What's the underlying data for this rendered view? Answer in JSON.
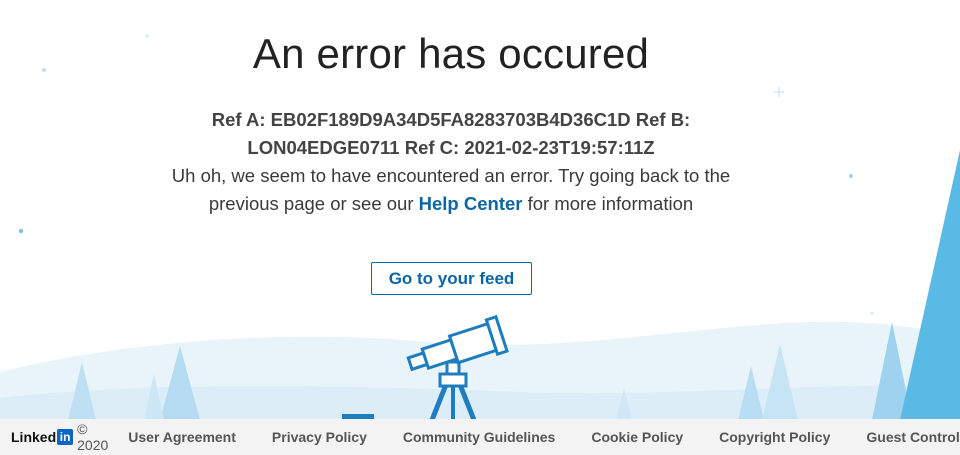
{
  "error": {
    "title": "An error has occured",
    "refs_line1": "Ref A: EB02F189D9A34D5FA8283703B4D36C1D Ref B:",
    "refs_line2": "LON04EDGE0711 Ref C: 2021-02-23T19:57:11Z",
    "message_part1": "Uh oh, we seem to have encountered an error. Try going back to the previous page or see our ",
    "help_link": "Help Center",
    "message_part2": " for more information"
  },
  "actions": {
    "feed_button": "Go to your feed"
  },
  "footer": {
    "brand_text": "Linked",
    "brand_in": "in",
    "copyright": "© 2020",
    "links": [
      "User Agreement",
      "Privacy Policy",
      "Community Guidelines",
      "Cookie Policy",
      "Copyright Policy",
      "Guest Controls"
    ]
  },
  "colors": {
    "accent": "#0a66a6",
    "sky_light": "#e8f3fa",
    "tree_blue": "#5bb9e6"
  },
  "icons": [
    "telescope-icon",
    "linkedin-logo-icon"
  ]
}
